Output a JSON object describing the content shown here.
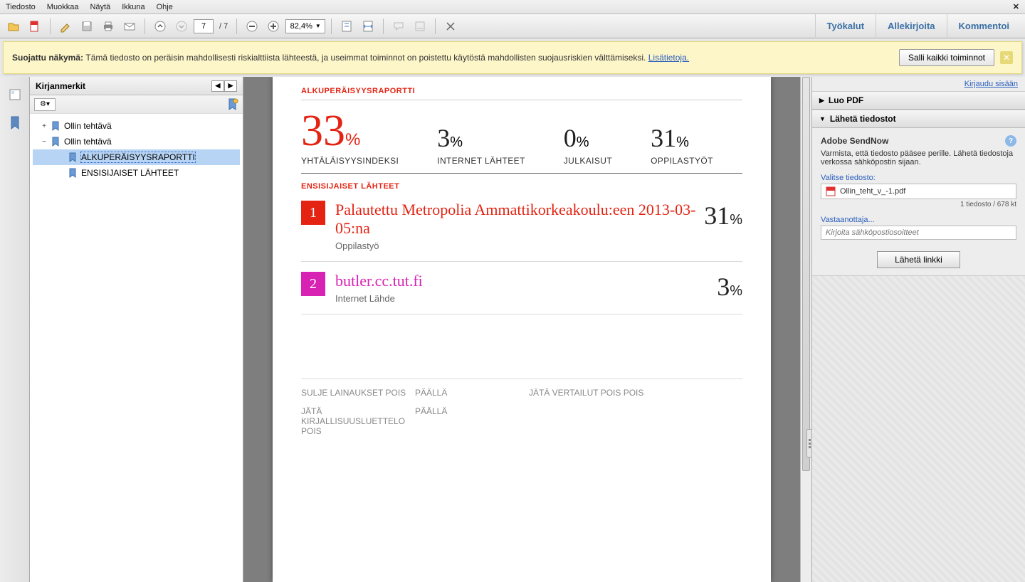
{
  "menu": {
    "items": [
      "Tiedosto",
      "Muokkaa",
      "Näytä",
      "Ikkuna",
      "Ohje"
    ]
  },
  "toolbar": {
    "page_current": "7",
    "page_total": "/ 7",
    "zoom": "82,4%",
    "tabs": {
      "tools": "Työkalut",
      "sign": "Allekirjoita",
      "comment": "Kommentoi"
    }
  },
  "secure": {
    "prefix": "Suojattu näkymä: ",
    "text": "Tämä tiedosto on peräisin mahdollisesti riskialttiista lähteestä, ja useimmat toiminnot on poistettu käytöstä mahdollisten suojausriskien välttämiseksi. ",
    "link": "Lisätietoja.",
    "allow": "Salli kaikki toiminnot"
  },
  "bookmarks": {
    "title": "Kirjanmerkit",
    "items": [
      {
        "label": "Ollin tehtävä",
        "indent": 1,
        "toggle": "+"
      },
      {
        "label": "Ollin tehtävä",
        "indent": 1,
        "toggle": "−"
      },
      {
        "label": "ALKUPERÄISYYSRAPORTTI",
        "indent": 2,
        "selected": true
      },
      {
        "label": "ENSISIJAISET LÄHTEET",
        "indent": 2
      }
    ]
  },
  "doc": {
    "section1": "ALKUPERÄISYYSRAPORTTI",
    "stats": [
      {
        "n": "33",
        "lbl": "YHTÄLÄISYYSINDEKSI",
        "big": true
      },
      {
        "n": "3",
        "lbl": "INTERNET LÄHTEET"
      },
      {
        "n": "0",
        "lbl": "JULKAISUT"
      },
      {
        "n": "31",
        "lbl": "OPPILASTYÖT"
      }
    ],
    "section2": "ENSISIJAISET LÄHTEET",
    "sources": [
      {
        "num": "1",
        "color": "red",
        "title": "Palautettu Metropolia Ammattikorkeakoulu:een 2013-03-05:na",
        "sub": "Oppilastyö",
        "pct": "31"
      },
      {
        "num": "2",
        "color": "mag",
        "title": "butler.cc.tut.fi",
        "sub": "Internet Lähde",
        "pct": "3"
      }
    ],
    "footer": [
      {
        "k": "SULJE LAINAUKSET POIS",
        "v": "PÄÄLLÄ"
      },
      {
        "k": "JÄTÄ VERTAILUT POIS",
        "v": "POIS"
      },
      {
        "k": "JÄTÄ KIRJALLISUUSLUETTELO POIS",
        "v": "PÄÄLLÄ"
      }
    ]
  },
  "right": {
    "login": "Kirjaudu sisään",
    "create": "Luo PDF",
    "send": "Lähetä tiedostot",
    "sendnow": "Adobe SendNow",
    "sendnow_desc": "Varmista, että tiedosto pääsee perille. Lähetä tiedostoja verkossa sähköpostin sijaan.",
    "pickfile": "Valitse tiedosto:",
    "filename": "Ollin_teht_v_-1.pdf",
    "filemeta": "1 tiedosto / 678 kt",
    "to": "Vastaanottaja...",
    "to_ph": "Kirjoita sähköpostiosoitteet",
    "sendbtn": "Lähetä linkki"
  }
}
